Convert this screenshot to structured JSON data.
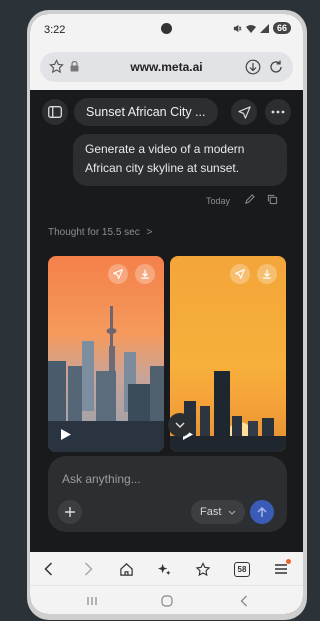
{
  "status_bar": {
    "time": "3:22",
    "battery": "66"
  },
  "browser": {
    "url": "www.meta.ai"
  },
  "chat": {
    "title": "Sunset African City ...",
    "user_message": "Generate a video of a modern African city skyline at sunset.",
    "message_time": "Today",
    "thought_label": "Thought for 15.5 sec",
    "thought_chevron": ">"
  },
  "composer": {
    "placeholder": "Ask anything...",
    "mode_label": "Fast"
  },
  "bottom_nav": {
    "tabs_count": "58"
  },
  "icons": {
    "sidebar": "sidebar-toggle-icon",
    "share": "send-icon",
    "more": "more-icon",
    "edit": "pencil-icon",
    "copy": "copy-icon",
    "download": "download-icon",
    "play": "play-icon"
  }
}
